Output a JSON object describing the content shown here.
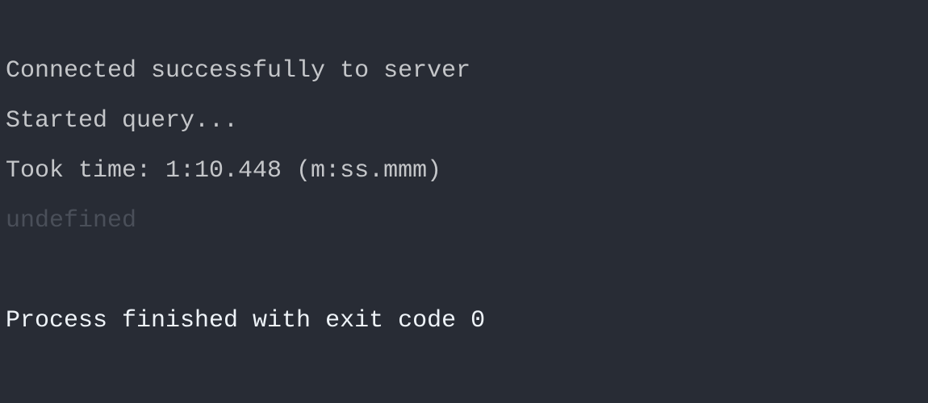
{
  "console": {
    "lines": [
      "Connected successfully to server",
      "Started query...",
      "Took time: 1:10.448 (m:ss.mmm)",
      "undefined"
    ],
    "exit_message": "Process finished with exit code 0"
  },
  "colors": {
    "background": "#282c35",
    "text": "#c4c6c9",
    "muted": "#4a4f59",
    "exit": "#eef3f8"
  }
}
